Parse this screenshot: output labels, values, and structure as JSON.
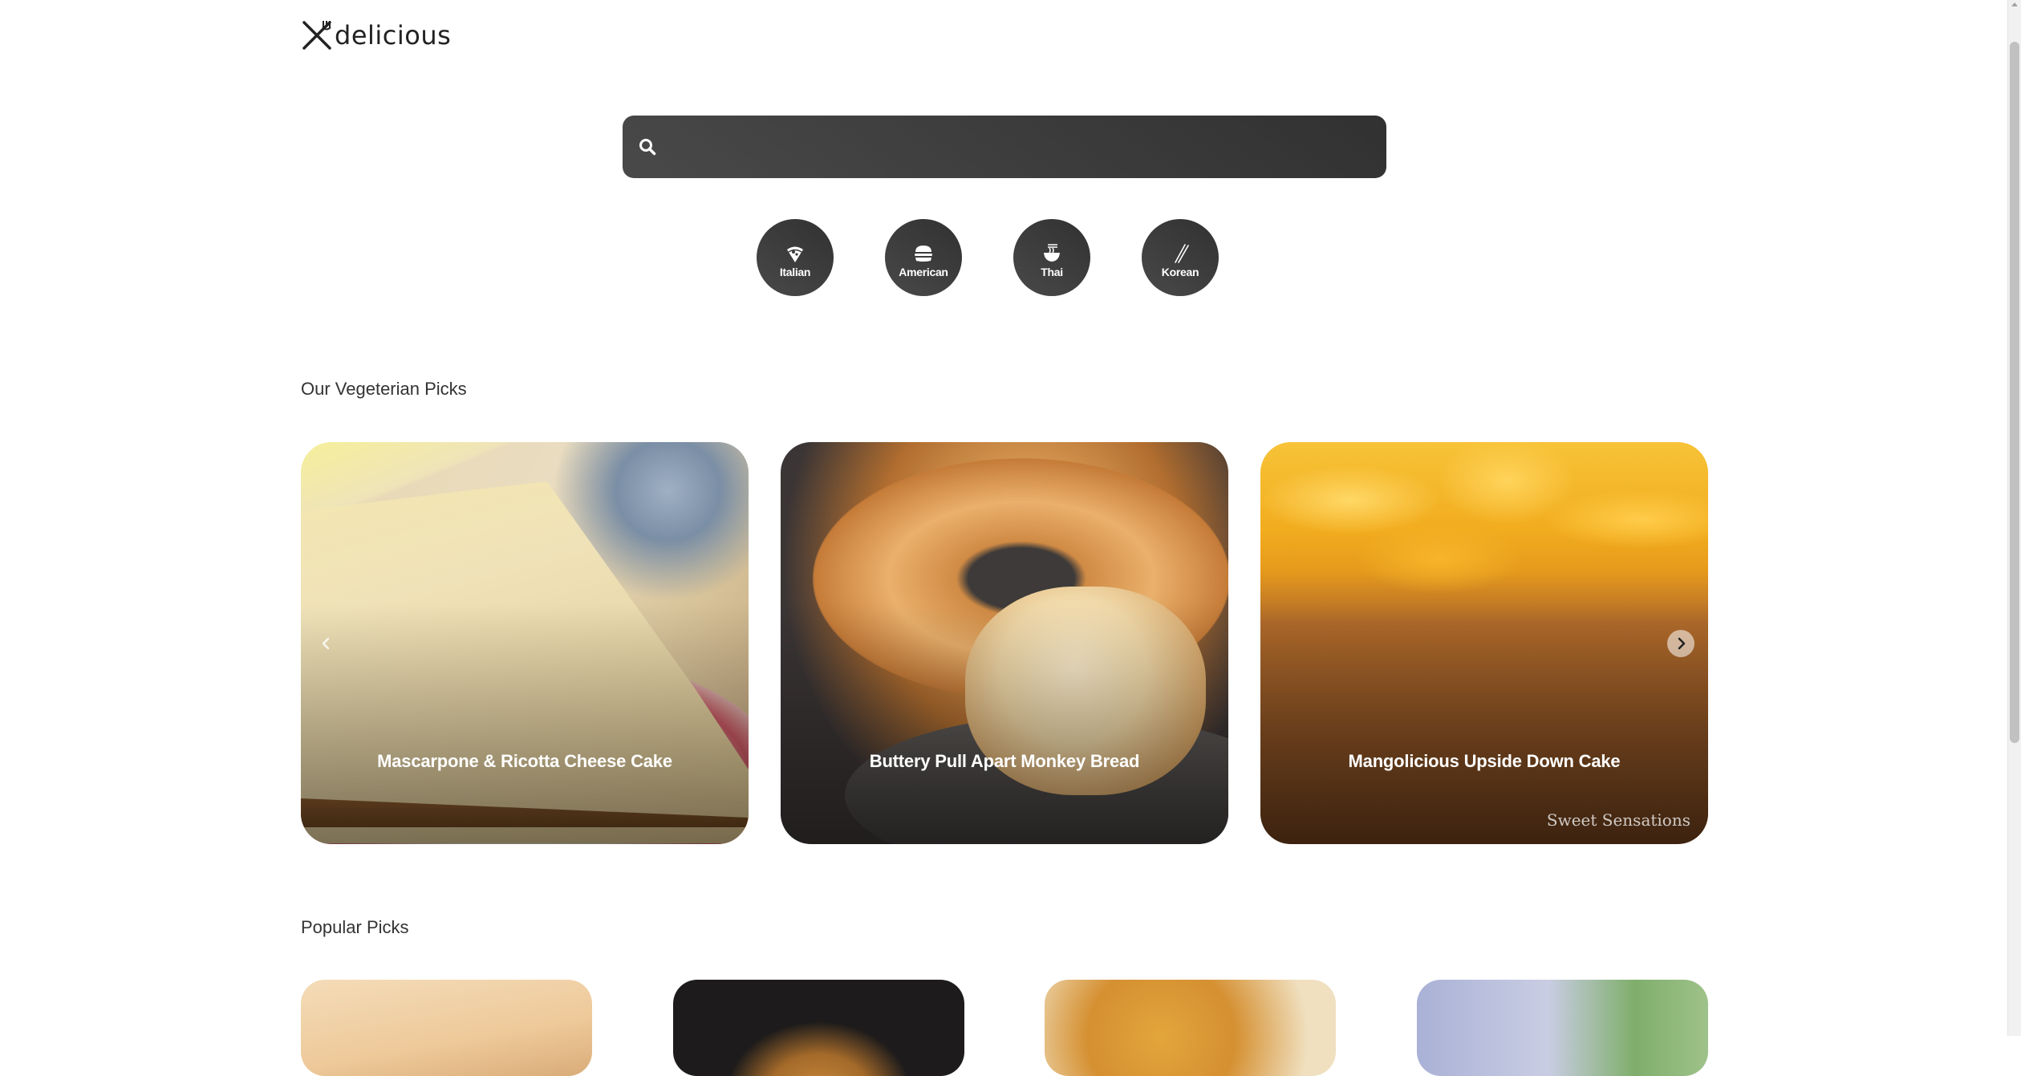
{
  "brand": {
    "name": "delicious"
  },
  "search": {
    "placeholder": "",
    "value": ""
  },
  "cuisines": [
    {
      "label": "Italian",
      "icon": "pizza-icon"
    },
    {
      "label": "American",
      "icon": "burger-icon"
    },
    {
      "label": "Thai",
      "icon": "noodle-bowl-icon"
    },
    {
      "label": "Korean",
      "icon": "chopsticks-icon"
    }
  ],
  "veggie": {
    "title": "Our Vegeterian Picks",
    "cards": [
      {
        "title": "Mascarpone & Ricotta Cheese Cake"
      },
      {
        "title": "Buttery Pull Apart Monkey Bread"
      },
      {
        "title": "Mangolicious Upside Down Cake",
        "watermark": "Sweet Sensations"
      }
    ]
  },
  "popular": {
    "title": "Popular Picks"
  }
}
